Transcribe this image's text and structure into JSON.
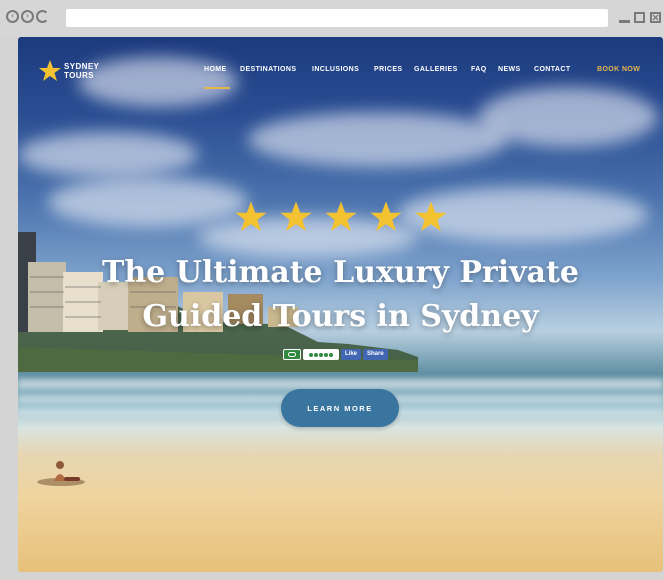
{
  "browser": {
    "controls": [
      "back",
      "forward",
      "reload"
    ],
    "window_buttons": [
      "minimize",
      "maximize",
      "close"
    ]
  },
  "site": {
    "logo": {
      "line1": "SYDNEY",
      "line2": "TOURS",
      "icon": "star-icon"
    },
    "nav": {
      "items": [
        "HOME",
        "DESTINATIONS",
        "INCLUSIONS",
        "PRICES",
        "GALLERIES",
        "FAQ",
        "NEWS",
        "CONTACT"
      ],
      "active": "HOME",
      "cta": "BOOK NOW"
    },
    "hero": {
      "rating_stars": 5,
      "headline_line1": "The Ultimate Luxury Private",
      "headline_line2": "Guided Tours in Sydney",
      "facebook_like": "Like",
      "facebook_share": "Share",
      "button": "LEARN MORE"
    },
    "colors": {
      "accent_gold": "#f2c230",
      "nav_cta": "#e8b54a",
      "button_blue": "#3a75a0",
      "tripadvisor_green": "#2f8a3f",
      "facebook_blue": "#4267b2"
    }
  }
}
